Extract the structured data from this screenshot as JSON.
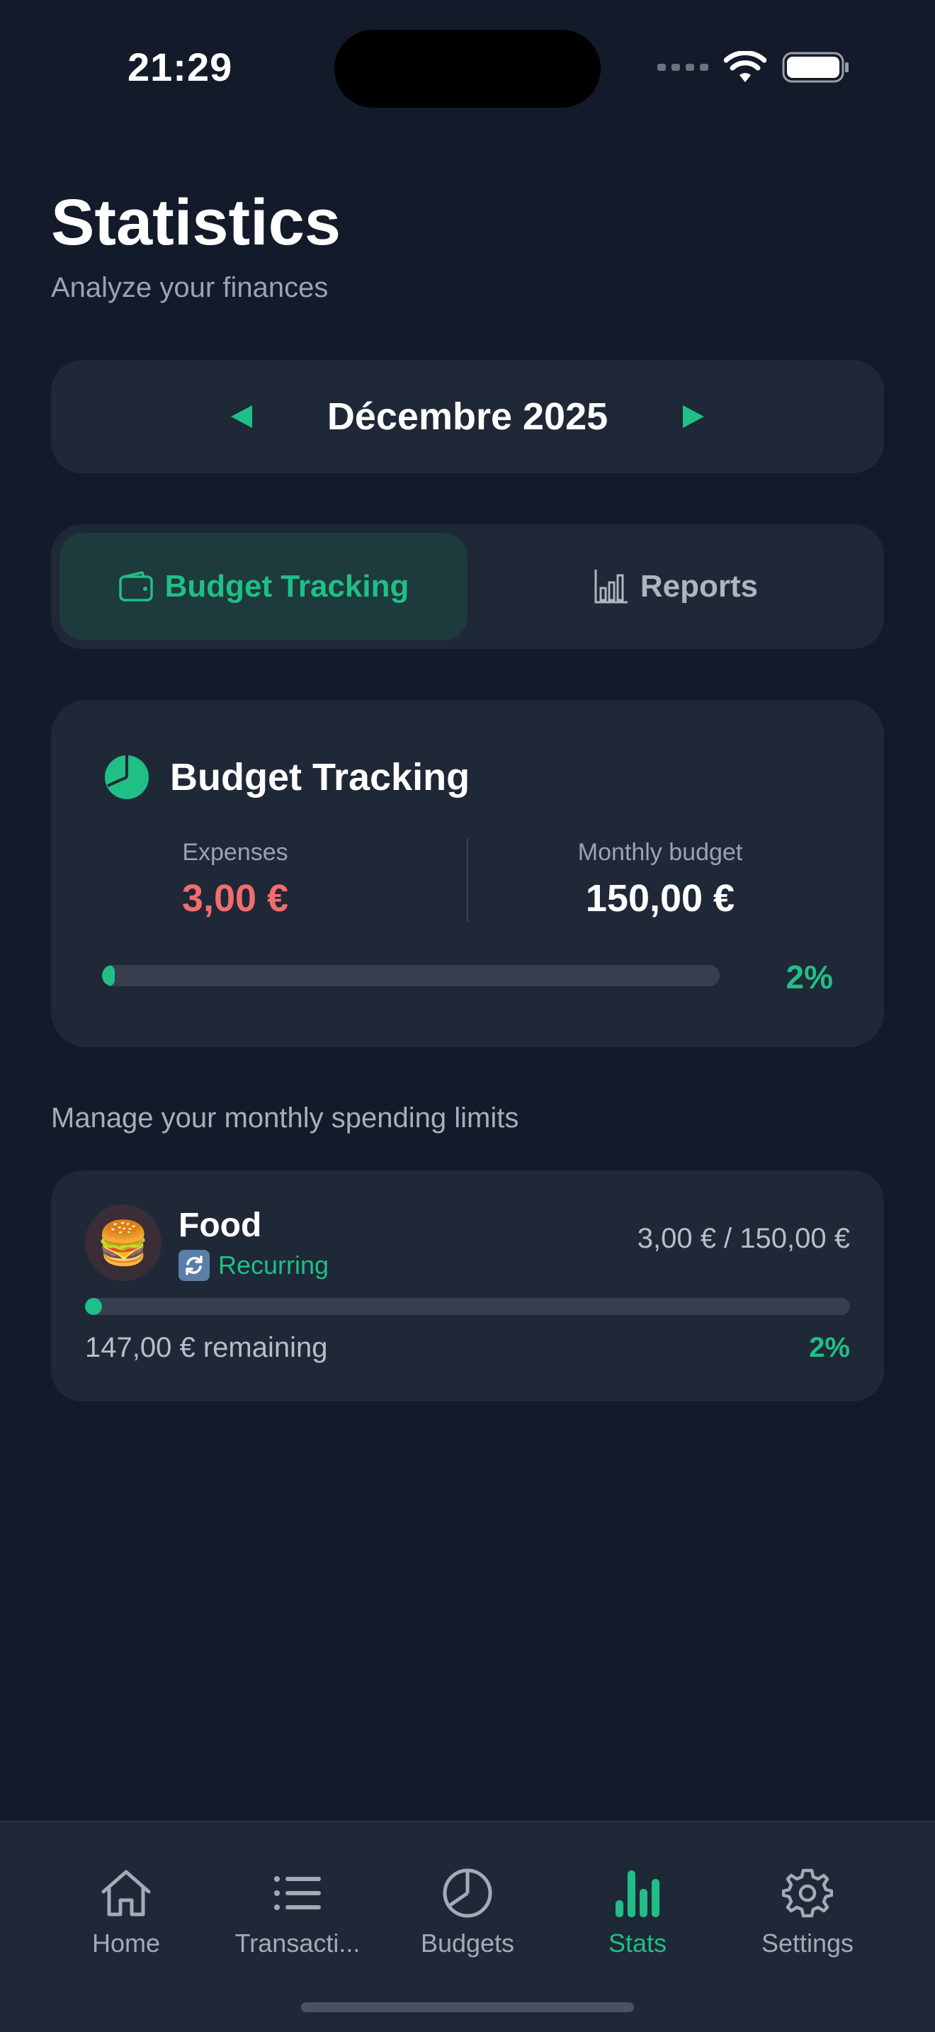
{
  "status_bar": {
    "time": "21:29"
  },
  "header": {
    "title": "Statistics",
    "subtitle": "Analyze your finances"
  },
  "month_selector": {
    "label": "Décembre 2025",
    "prev_icon": "triangle-left-icon",
    "next_icon": "triangle-right-icon"
  },
  "segments": {
    "budget_tracking": {
      "label": "Budget Tracking",
      "icon": "wallet-icon",
      "selected": true
    },
    "reports": {
      "label": "Reports",
      "icon": "bar-chart-icon",
      "selected": false
    }
  },
  "budget_card": {
    "title": "Budget Tracking",
    "icon": "pie-chart-icon",
    "expenses_label": "Expenses",
    "expenses_value": "3,00 €",
    "budget_label": "Monthly budget",
    "budget_value": "150,00 €",
    "progress": 0.02,
    "percent_label": "2%"
  },
  "section_note": "Manage your monthly spending limits",
  "categories": [
    {
      "emoji": "🍔",
      "name": "Food",
      "recurring_label": "Recurring",
      "amount": "3,00 € / 150,00 €",
      "progress": 0.02,
      "remaining": "147,00 € remaining",
      "percent_label": "2%"
    }
  ],
  "tabbar": {
    "home": "Home",
    "transactions": "Transacti...",
    "budgets": "Budgets",
    "stats": "Stats",
    "settings": "Settings",
    "active": "stats"
  },
  "colors": {
    "accent": "#1fbf86",
    "expense": "#f26d6d",
    "background": "#131a2a",
    "card": "#1f2837"
  }
}
